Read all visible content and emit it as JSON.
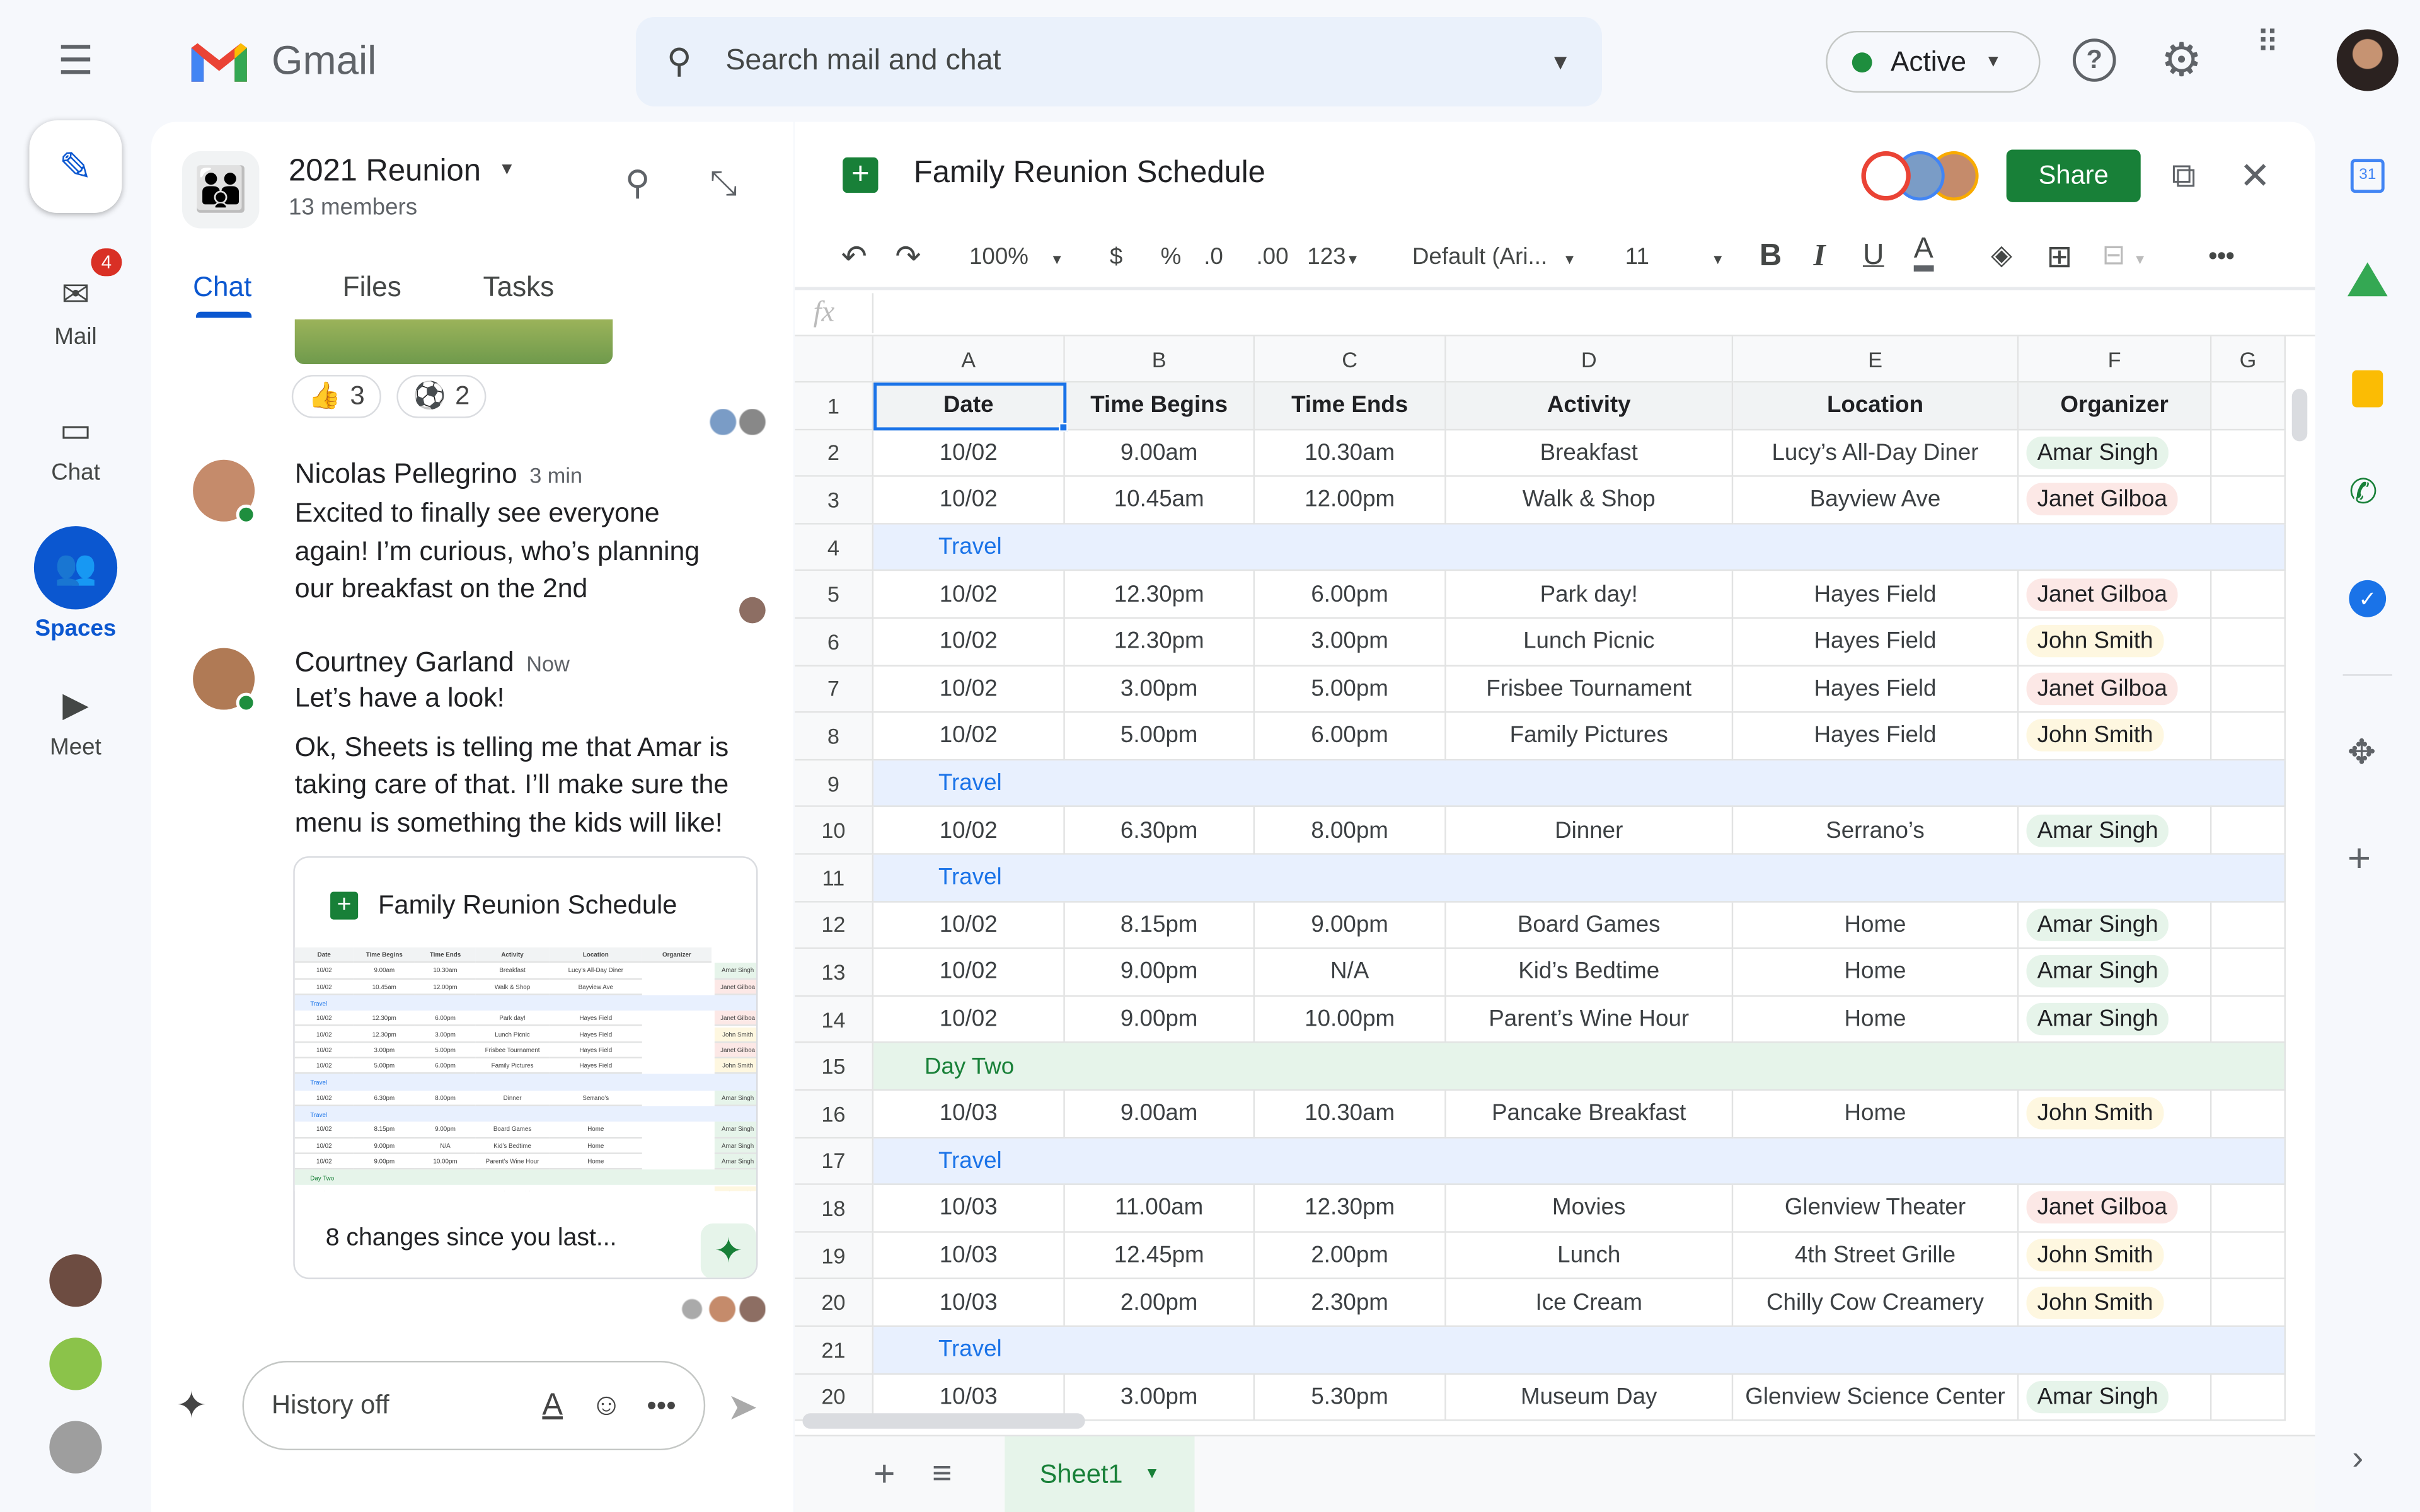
{
  "app": {
    "name": "Gmail",
    "search_placeholder": "Search mail and chat",
    "status": "Active",
    "mail_badge": "4"
  },
  "rail": [
    {
      "label": "Mail",
      "icon": "mail-icon"
    },
    {
      "label": "Chat",
      "icon": "chat-icon"
    },
    {
      "label": "Spaces",
      "icon": "spaces-icon"
    },
    {
      "label": "Meet",
      "icon": "video-icon"
    }
  ],
  "space": {
    "name": "2021 Reunion",
    "members": "13 members",
    "tabs": [
      "Chat",
      "Files",
      "Tasks"
    ],
    "active_tab": "Chat"
  },
  "reactions": [
    {
      "emoji": "👍",
      "count": "3"
    },
    {
      "emoji": "⚽",
      "count": "2"
    }
  ],
  "messages": [
    {
      "name": "Nicolas Pellegrino",
      "time": "3 min",
      "text": "Excited to finally see everyone again! I’m curious, who’s planning our breakfast on the 2nd"
    },
    {
      "name": "Courtney Garland",
      "time": "Now",
      "text": "Let’s have a look!",
      "text2": "Ok, Sheets is telling me that Amar is taking care of that. I’ll make sure the menu is something the kids will like!"
    }
  ],
  "card": {
    "title": "Family Reunion Schedule",
    "footer": "8 changes since you last..."
  },
  "composer": {
    "placeholder": "History off"
  },
  "sheet": {
    "title": "Family Reunion Schedule",
    "share": "Share",
    "zoom": "100%",
    "currency": "$",
    "percent": "%",
    "dec_less": ".0",
    "dec_more": ".00",
    "format": "123",
    "font": "Default (Ari...",
    "font_size": "11",
    "fx": "fx",
    "tab": "Sheet1",
    "columns": [
      "A",
      "B",
      "C",
      "D",
      "E",
      "F",
      "G"
    ],
    "headers": [
      "Date",
      "Time Begins",
      "Time Ends",
      "Activity",
      "Location",
      "Organizer"
    ],
    "colors": {
      "Amar Singh": "#e6f4ea",
      "Janet Gilboa": "#fce8e6",
      "John Smith": "#fef7e0",
      "travel_bg": "#e8f0fe",
      "travel_text": "#1a73e8",
      "daytwo_bg": "#e6f4ea",
      "daytwo_text": "#188038",
      "accent": "#188038"
    },
    "rows": [
      [
        "10/02",
        "9.00am",
        "10.30am",
        "Breakfast",
        "Lucy’s All-Day Diner",
        "Amar Singh"
      ],
      [
        "10/02",
        "10.45am",
        "12.00pm",
        "Walk & Shop",
        "Bayview Ave",
        "Janet Gilboa"
      ],
      [
        "Travel"
      ],
      [
        "10/02",
        "12.30pm",
        "6.00pm",
        "Park day!",
        "Hayes Field",
        "Janet Gilboa"
      ],
      [
        "10/02",
        "12.30pm",
        "3.00pm",
        "Lunch Picnic",
        "Hayes Field",
        "John Smith"
      ],
      [
        "10/02",
        "3.00pm",
        "5.00pm",
        "Frisbee Tournament",
        "Hayes Field",
        "Janet Gilboa"
      ],
      [
        "10/02",
        "5.00pm",
        "6.00pm",
        "Family Pictures",
        "Hayes Field",
        "John Smith"
      ],
      [
        "Travel"
      ],
      [
        "10/02",
        "6.30pm",
        "8.00pm",
        "Dinner",
        "Serrano’s",
        "Amar Singh"
      ],
      [
        "Travel"
      ],
      [
        "10/02",
        "8.15pm",
        "9.00pm",
        "Board Games",
        "Home",
        "Amar Singh"
      ],
      [
        "10/02",
        "9.00pm",
        "N/A",
        "Kid’s Bedtime",
        "Home",
        "Amar Singh"
      ],
      [
        "10/02",
        "9.00pm",
        "10.00pm",
        "Parent’s Wine Hour",
        "Home",
        "Amar Singh"
      ],
      [
        "Day Two"
      ],
      [
        "10/03",
        "9.00am",
        "10.30am",
        "Pancake Breakfast",
        "Home",
        "John Smith"
      ],
      [
        "Travel"
      ],
      [
        "10/03",
        "11.00am",
        "12.30pm",
        "Movies",
        "Glenview Theater",
        "Janet Gilboa"
      ],
      [
        "10/03",
        "12.45pm",
        "2.00pm",
        "Lunch",
        "4th Street Grille",
        "John Smith"
      ],
      [
        "10/03",
        "2.00pm",
        "2.30pm",
        "Ice Cream",
        "Chilly Cow Creamery",
        "John Smith"
      ],
      [
        "Travel"
      ],
      [
        "10/03",
        "3.00pm",
        "5.30pm",
        "Museum Day",
        "Glenview Science Center",
        "Amar Singh"
      ]
    ],
    "row_numbers": [
      "1",
      "2",
      "3",
      "4",
      "5",
      "6",
      "7",
      "8",
      "9",
      "10",
      "11",
      "12",
      "13",
      "14",
      "15",
      "16",
      "17",
      "18",
      "19",
      "20",
      "21",
      "20"
    ]
  }
}
